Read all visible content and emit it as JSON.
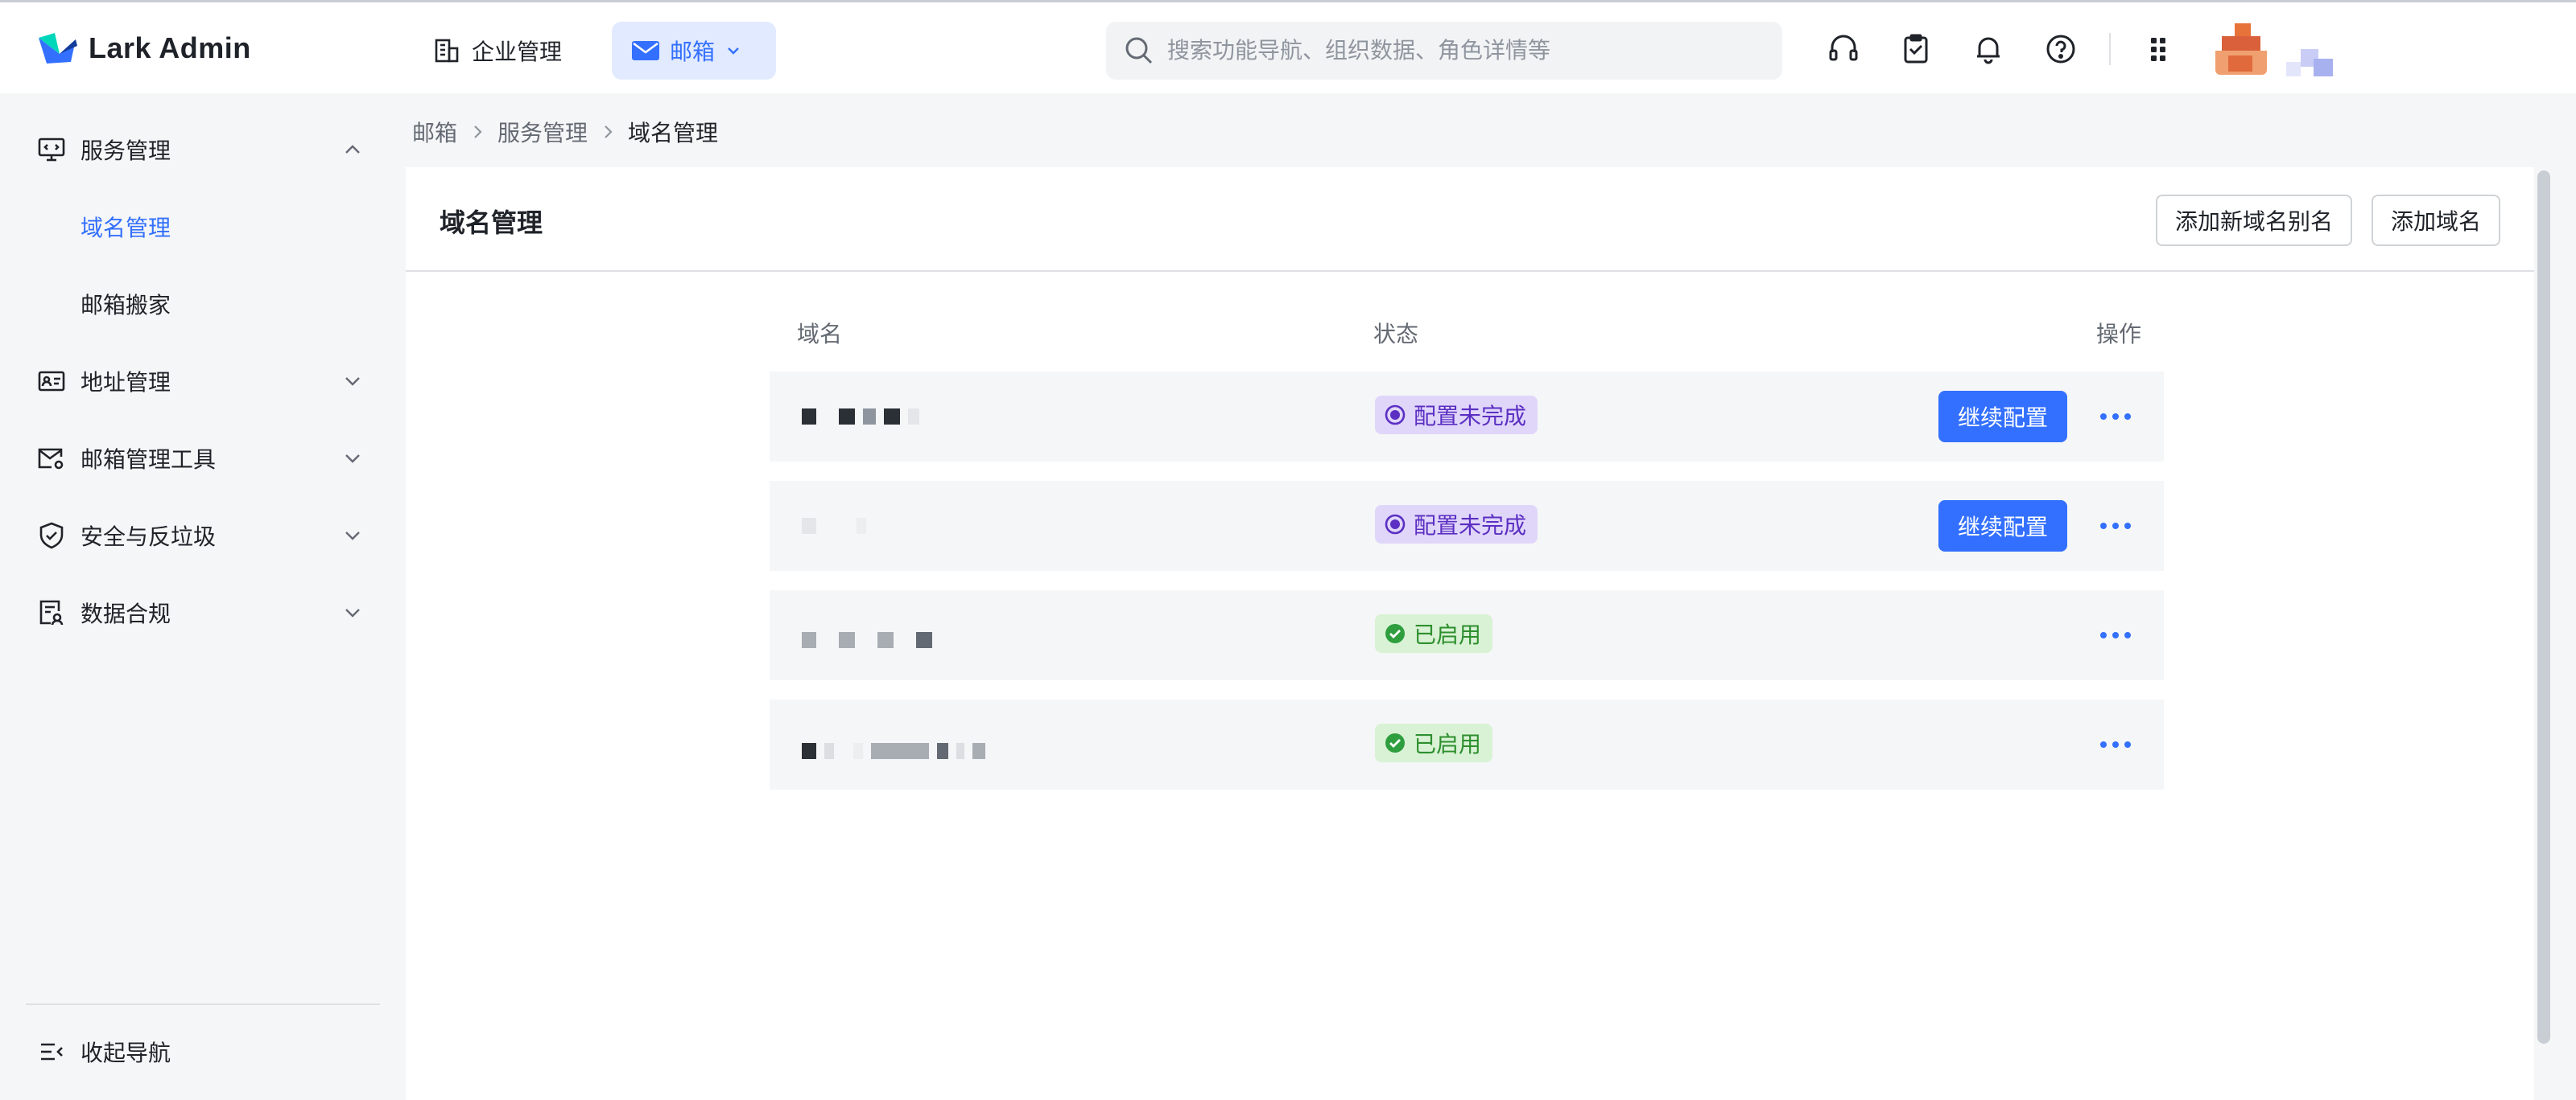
{
  "app": {
    "brand": "Lark Admin"
  },
  "header": {
    "nav_enterprise": "企业管理",
    "nav_mail": "邮箱",
    "search_placeholder": "搜索功能导航、组织数据、角色详情等"
  },
  "sidebar": {
    "items": [
      {
        "label": "服务管理",
        "expanded": true,
        "icon": "monitor-icon"
      },
      {
        "label": "域名管理",
        "active": true
      },
      {
        "label": "邮箱搬家"
      },
      {
        "label": "地址管理",
        "icon": "address-card-icon"
      },
      {
        "label": "邮箱管理工具",
        "icon": "mail-settings-icon"
      },
      {
        "label": "安全与反垃圾",
        "icon": "shield-check-icon"
      },
      {
        "label": "数据合规",
        "icon": "data-compliance-icon"
      }
    ],
    "collapse_label": "收起导航"
  },
  "breadcrumb": [
    "邮箱",
    "服务管理",
    "域名管理"
  ],
  "main": {
    "title": "域名管理",
    "btn_add_alias": "添加新域名别名",
    "btn_add_domain": "添加域名",
    "columns": {
      "domain": "域名",
      "status": "状态",
      "actions": "操作"
    },
    "rows": [
      {
        "status": "配置未完成",
        "status_type": "pending",
        "action": "继续配置"
      },
      {
        "status": "配置未完成",
        "status_type": "pending",
        "action": "继续配置"
      },
      {
        "status": "已启用",
        "status_type": "active",
        "action": ""
      },
      {
        "status": "已启用",
        "status_type": "active",
        "action": ""
      }
    ]
  },
  "colors": {
    "accent": "#3370ff",
    "pending": "#5b2fc2",
    "active": "#2e8f2e"
  }
}
